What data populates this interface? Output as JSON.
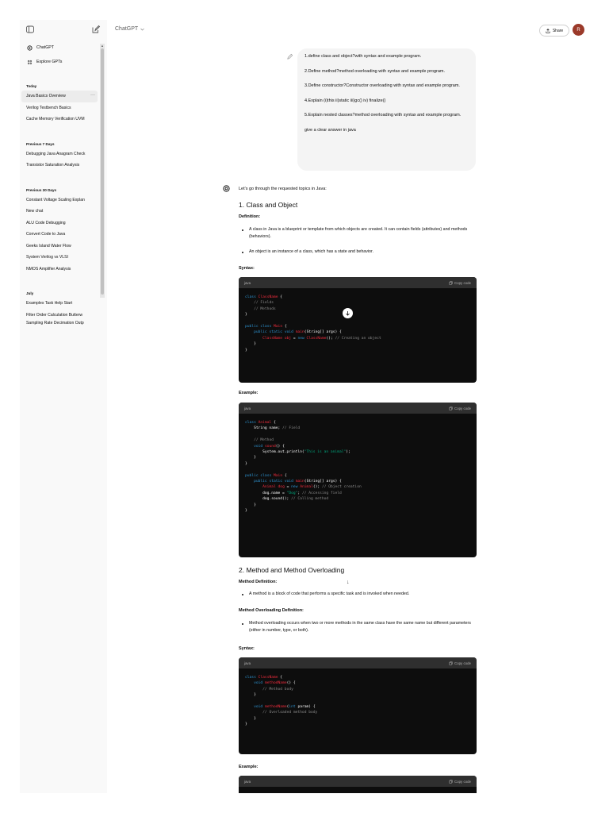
{
  "header": {
    "model": "ChatGPT",
    "share_label": "Share",
    "avatar_letter": "R"
  },
  "sidebar": {
    "nav": [
      {
        "label": "ChatGPT"
      },
      {
        "label": "Explore GPTs"
      }
    ],
    "sections": [
      {
        "title": "Today",
        "items": [
          "Java Basics Overview",
          "Verilog Testbench Basics",
          "Cache Memory Verification UVM"
        ]
      },
      {
        "title": "Previous 7 Days",
        "items": [
          "Debugging Java Anagram Check",
          "Transistor Saturation Analysis"
        ]
      },
      {
        "title": "Previous 30 Days",
        "items": [
          "Constant Voltage Scaling Explan",
          "New chat",
          "ALU Code Debugging",
          "Convert Code to Java",
          "Geeks Island Water Flow",
          "System Verilog vs VLSI",
          "NMOS Amplifier Analysis"
        ]
      },
      {
        "title": "July",
        "items": [
          "Examples Task Help Start",
          "Filter Order Calculation Butterw",
          "Sampling Rate Decimation Outp"
        ]
      }
    ]
  },
  "user_message": {
    "lines": [
      "1.define class and object?with syntax and example program.",
      "2.Define method?method overloading with syntax and example program.",
      "3.Define constructor?Constructor overloading with syntax and example program.",
      "4.Explain (i)this ii)static iii)gc() iv) finalize()",
      "5.Explain nested classes?method overloading with syntax and example program.",
      "give a clear answer in java"
    ]
  },
  "answer": {
    "intro": "Let's go through the requested topics in Java:",
    "s1_title": "1. Class and Object",
    "s1_def_label": "Definition:",
    "s1_b1": "A class in Java is a blueprint or template from which objects are created. It can contain fields (attributes) and methods (behaviors).",
    "s1_b2": "An object is an instance of a class, which has a state and behavior.",
    "syntax_label": "Syntax:",
    "example_label": "Example:",
    "s2_title": "2. Method and Method Overloading",
    "s2_def_label": "Method Definition:",
    "s2_b1": "A method is a block of code that performs a specific task and is invoked when needed.",
    "s2_ov_label": "Method Overloading Definition:",
    "s2_b2": "Method overloading occurs when two or more methods in the same class have the same name but different parameters (either in number, type, or both)."
  },
  "code": {
    "lang": "java",
    "copy_label": "Copy code"
  }
}
